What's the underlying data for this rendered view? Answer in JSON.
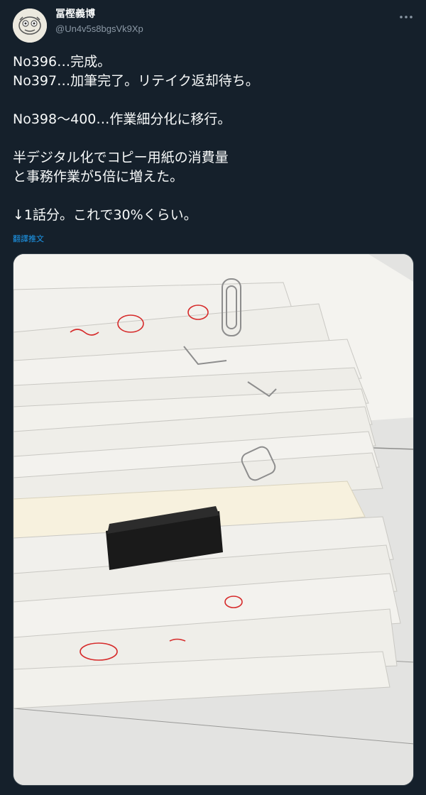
{
  "tweet": {
    "author": {
      "display_name": "冨樫義博",
      "handle": "@Un4v5s8bgsVk9Xp"
    },
    "more_icon": "ellipsis-icon",
    "lines": [
      "No396…完成。",
      "No397…加筆完了。リテイク返却待ち。",
      "",
      "No398〜400…作業細分化に移行。",
      "",
      "半デジタル化でコピー用紙の消費量",
      "と事務作業が5倍に増えた。",
      "",
      "↓1話分。これで30%くらい。"
    ],
    "translate_label": "翻譯推文"
  },
  "media": {
    "description": "stack of manuscript papers with clips",
    "colors": {
      "paper": "#f1f0ec",
      "table": "#e7e7e5",
      "red_ink": "#d62a2a",
      "binder_clip": "#1a1a1a"
    }
  }
}
